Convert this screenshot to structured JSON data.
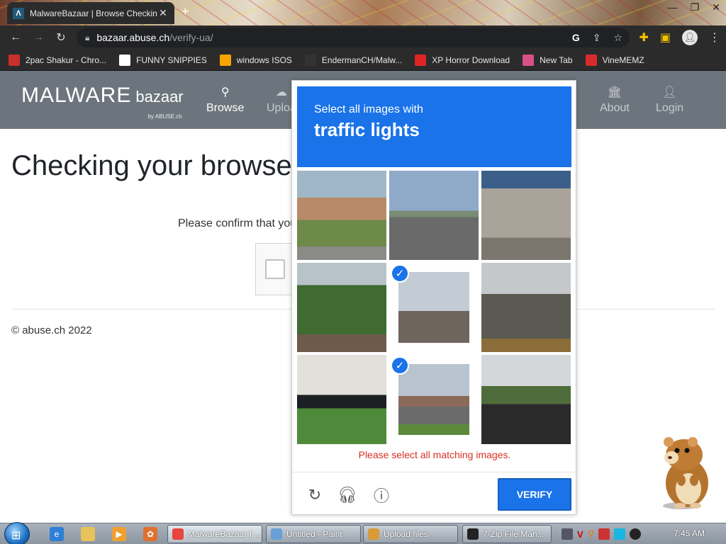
{
  "browser": {
    "tab_title": "MalwareBazaar | Browse Checkin",
    "url_host": "bazaar.abuse.ch",
    "url_path": "/verify-ua/",
    "bookmarks": [
      {
        "label": "2pac Shakur - Chro...",
        "icon": "tupac-icon",
        "color": "#c9302c"
      },
      {
        "label": "FUNNY SNIPPIES",
        "icon": "h-icon",
        "color": "#ffffff"
      },
      {
        "label": "windows ISOS",
        "icon": "ph-icon",
        "color": "#f7a400"
      },
      {
        "label": "EndermanCH/Malw...",
        "icon": "yp-icon",
        "color": "#333333"
      },
      {
        "label": "XP Horror Download",
        "icon": "x-icon",
        "color": "#e02424"
      },
      {
        "label": "New Tab",
        "icon": "globe-icon",
        "color": "#d94f8a"
      },
      {
        "label": "VineMEMZ",
        "icon": "r-icon",
        "color": "#d92b2b"
      }
    ]
  },
  "site": {
    "logo_main": "MALWARE",
    "logo_sub": "bazaar",
    "logo_by": "by ABUSE.ch",
    "nav": [
      {
        "label": "Browse",
        "icon": "search-icon"
      },
      {
        "label": "Uploa",
        "icon": "cloud-upload-icon"
      },
      {
        "label": "About",
        "icon": "building-icon"
      },
      {
        "label": "Login",
        "icon": "user-icon"
      }
    ],
    "page_title": "Checking your browse",
    "confirm_text": "Please confirm that you",
    "footer": "© abuse.ch 2022"
  },
  "captcha": {
    "instruction": "Select all images with",
    "target": "traffic lights",
    "error": "Please select all matching images.",
    "verify_label": "VERIFY",
    "tiles": [
      {
        "subject": "street-houses",
        "selected": false
      },
      {
        "subject": "highway-overpass",
        "selected": false
      },
      {
        "subject": "overpass-pillars",
        "selected": false
      },
      {
        "subject": "trees-house",
        "selected": false
      },
      {
        "subject": "traffic-light-intersection",
        "selected": true
      },
      {
        "subject": "traffic-light-hillside",
        "selected": false
      },
      {
        "subject": "parked-car-driveway",
        "selected": false
      },
      {
        "subject": "traffic-light-road",
        "selected": true
      },
      {
        "subject": "fence-motorcycles",
        "selected": false
      }
    ]
  },
  "taskbar": {
    "windows": [
      {
        "label": "MalwareBazaar | ...",
        "icon": "chrome-icon"
      },
      {
        "label": "Untitled - Paint",
        "icon": "paint-icon"
      },
      {
        "label": "Upload files",
        "icon": "upload-files-icon"
      },
      {
        "label": "7-Zip File Man...",
        "icon": "7zip-icon"
      }
    ],
    "clock": "7:45 AM"
  }
}
